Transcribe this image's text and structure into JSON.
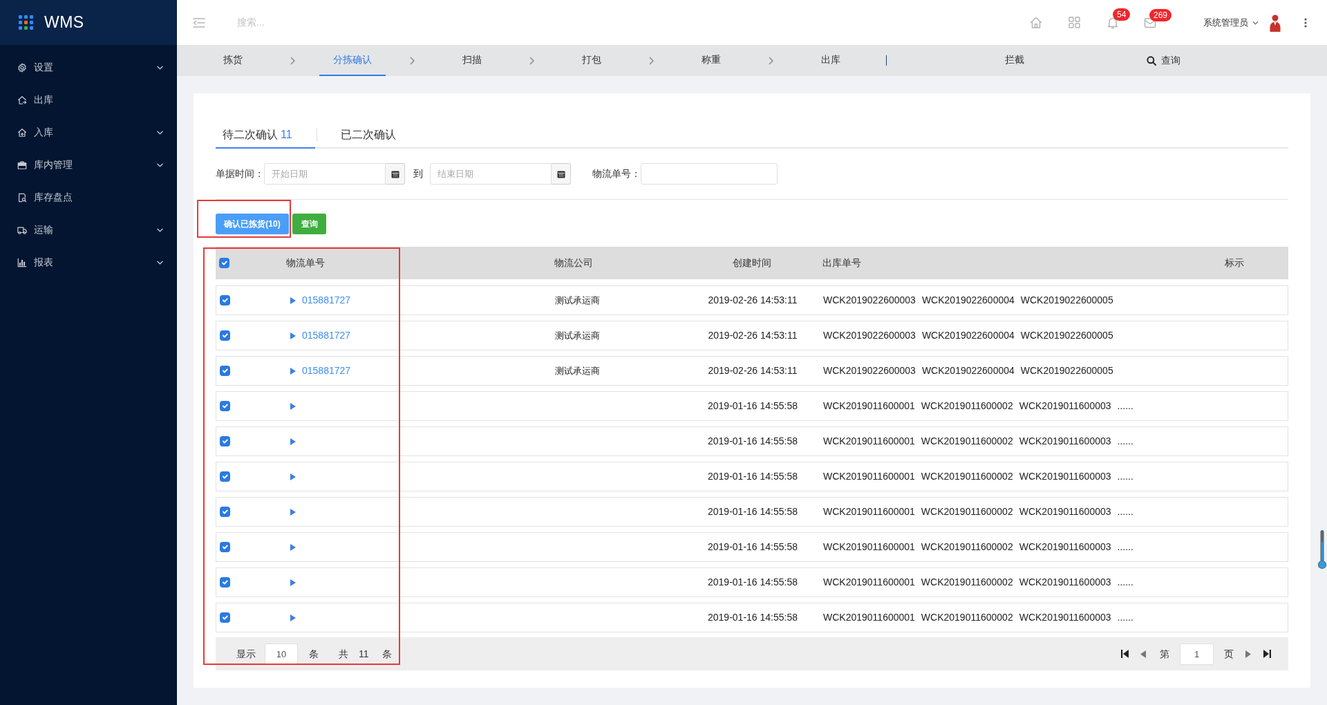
{
  "sidebar": {
    "logo": "WMS",
    "items": [
      {
        "label": "设置",
        "kind": "group",
        "expanded": false
      },
      {
        "label": "出库",
        "kind": "link"
      },
      {
        "label": "入库",
        "kind": "group",
        "expanded": false
      },
      {
        "label": "库内管理",
        "kind": "group",
        "expanded": false
      },
      {
        "label": "库存盘点",
        "kind": "link"
      },
      {
        "label": "运输",
        "kind": "group",
        "expanded": false
      },
      {
        "label": "报表",
        "kind": "group",
        "expanded": false
      }
    ]
  },
  "topbar": {
    "search": {
      "placeholder": "搜索..."
    },
    "notifications": {
      "badge": "54"
    },
    "messages": {
      "badge": "269"
    },
    "user": {
      "name": "系统管理员"
    }
  },
  "workflow": {
    "steps": [
      {
        "label": "拣货",
        "selected": false
      },
      {
        "label": "分拣确认",
        "selected": true
      },
      {
        "label": "扫描",
        "selected": false
      },
      {
        "label": "打包",
        "selected": false
      },
      {
        "label": "称重",
        "selected": false
      },
      {
        "label": "出库",
        "selected": false
      }
    ],
    "aside": [
      {
        "label": "拦截",
        "selected": false
      }
    ],
    "search_button": "查询"
  },
  "tabs": [
    {
      "label": "待二次确认",
      "count": "11",
      "selected": true
    },
    {
      "label": "已二次确认",
      "selected": false
    }
  ],
  "filters": {
    "date_label": "单据时间：",
    "start": {
      "placeholder": "开始日期"
    },
    "range_separator": "到",
    "end": {
      "placeholder": "结束日期"
    },
    "tracking_label": "物流单号："
  },
  "actions": [
    {
      "label": "确认已拣货(10)",
      "kind": "primary",
      "highlighted": true
    },
    {
      "label": "查询",
      "kind": "success",
      "highlighted": false
    }
  ],
  "table": {
    "highlighted": true,
    "select_all": {
      "checked": true
    },
    "columns": [
      "物流单号",
      "物流公司",
      "创建时间",
      "出库单号",
      "标示"
    ],
    "rows": [
      {
        "checked": true,
        "expanded": false,
        "tracking_no": "015881727",
        "carrier": "测试承运商",
        "created": "2019-02-26 14:53:11",
        "outbound_nos": [
          "WCK2019022600003",
          "WCK2019022600004",
          "WCK2019022600005"
        ]
      },
      {
        "checked": true,
        "expanded": false,
        "tracking_no": "015881727",
        "carrier": "测试承运商",
        "created": "2019-02-26 14:53:11",
        "outbound_nos": [
          "WCK2019022600003",
          "WCK2019022600004",
          "WCK2019022600005"
        ]
      },
      {
        "checked": true,
        "expanded": false,
        "tracking_no": "015881727",
        "carrier": "测试承运商",
        "created": "2019-02-26 14:53:11",
        "outbound_nos": [
          "WCK2019022600003",
          "WCK2019022600004",
          "WCK2019022600005"
        ]
      },
      {
        "checked": true,
        "expanded": false,
        "created": "2019-01-16 14:55:58",
        "outbound_nos": [
          "WCK2019011600001",
          "WCK2019011600002",
          "WCK2019011600003"
        ],
        "more": "......"
      },
      {
        "checked": true,
        "expanded": false,
        "created": "2019-01-16 14:55:58",
        "outbound_nos": [
          "WCK2019011600001",
          "WCK2019011600002",
          "WCK2019011600003"
        ],
        "more": "......"
      },
      {
        "checked": true,
        "expanded": false,
        "created": "2019-01-16 14:55:58",
        "outbound_nos": [
          "WCK2019011600001",
          "WCK2019011600002",
          "WCK2019011600003"
        ],
        "more": "......"
      },
      {
        "checked": true,
        "expanded": false,
        "created": "2019-01-16 14:55:58",
        "outbound_nos": [
          "WCK2019011600001",
          "WCK2019011600002",
          "WCK2019011600003"
        ],
        "more": "......"
      },
      {
        "checked": true,
        "expanded": false,
        "created": "2019-01-16 14:55:58",
        "outbound_nos": [
          "WCK2019011600001",
          "WCK2019011600002",
          "WCK2019011600003"
        ],
        "more": "......"
      },
      {
        "checked": true,
        "expanded": false,
        "created": "2019-01-16 14:55:58",
        "outbound_nos": [
          "WCK2019011600001",
          "WCK2019011600002",
          "WCK2019011600003"
        ],
        "more": "......"
      },
      {
        "checked": true,
        "expanded": false,
        "created": "2019-01-16 14:55:58",
        "outbound_nos": [
          "WCK2019011600001",
          "WCK2019011600002",
          "WCK2019011600003"
        ],
        "more": "......"
      }
    ]
  },
  "pagination": {
    "show_label": "显示",
    "page_size": "10",
    "size_unit": "条",
    "total_label": "共",
    "total": "11",
    "total_unit": "条",
    "page_label": "第",
    "page": "1",
    "page_unit": "页"
  }
}
